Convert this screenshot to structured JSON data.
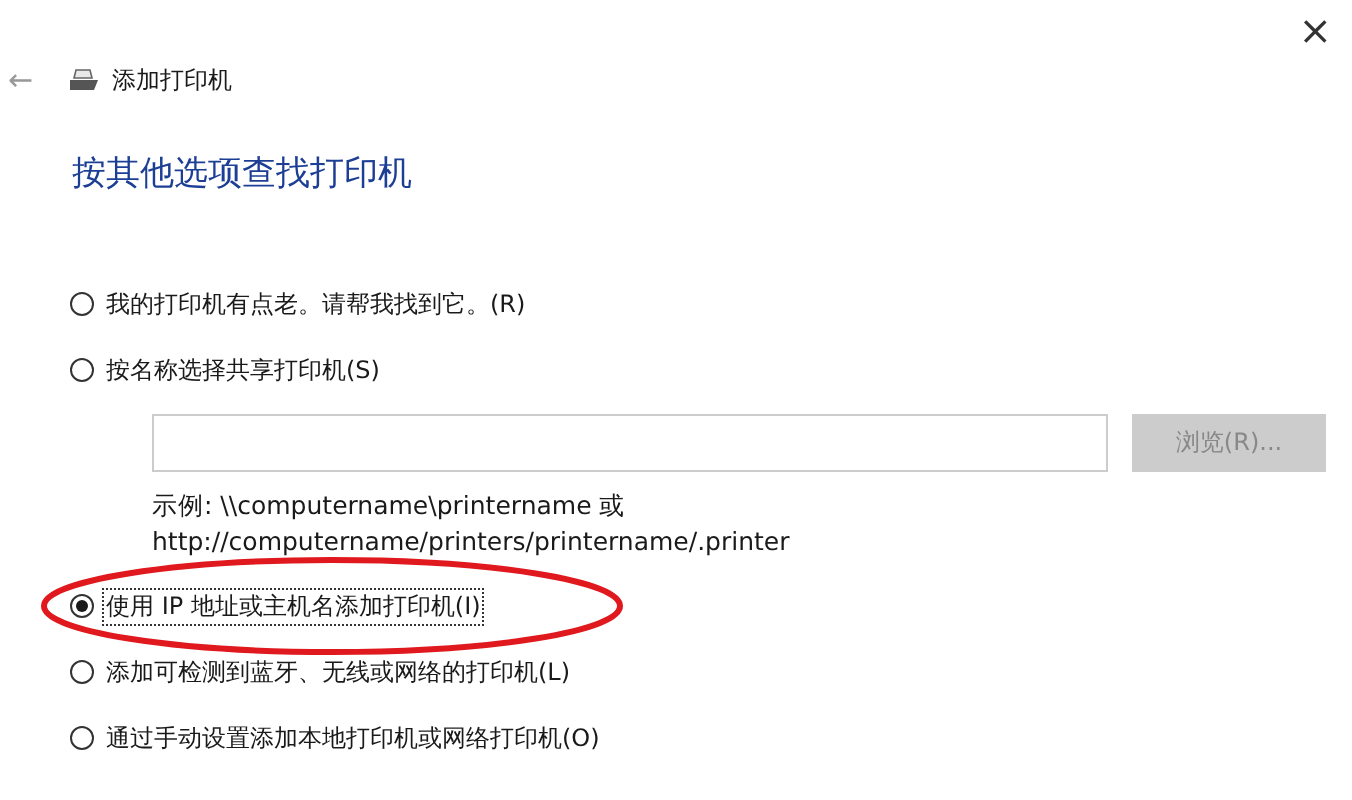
{
  "window": {
    "title": "添加打印机",
    "close": "×",
    "back": "←"
  },
  "heading": "按其他选项查找打印机",
  "options": [
    {
      "label": "我的打印机有点老。请帮我找到它。(R)",
      "selected": false,
      "focused": false,
      "circled": false
    },
    {
      "label": "按名称选择共享打印机(S)",
      "selected": false,
      "focused": false,
      "circled": false,
      "share_field": {
        "browse": {
          "label": "浏览(R)...",
          "disabled": true
        },
        "example": [
          "示例: \\\\computername\\printername 或",
          "http://computername/printers/printername/.printer"
        ]
      }
    },
    {
      "label": "使用 IP 地址或主机名添加打印机(I)",
      "selected": true,
      "focused": true,
      "circled": true
    },
    {
      "label": "添加可检测到蓝牙、无线或网络的打印机(L)",
      "selected": false,
      "focused": false,
      "circled": false
    },
    {
      "label": "通过手动设置添加本地打印机或网络打印机(O)",
      "selected": false,
      "focused": false,
      "circled": false
    }
  ]
}
